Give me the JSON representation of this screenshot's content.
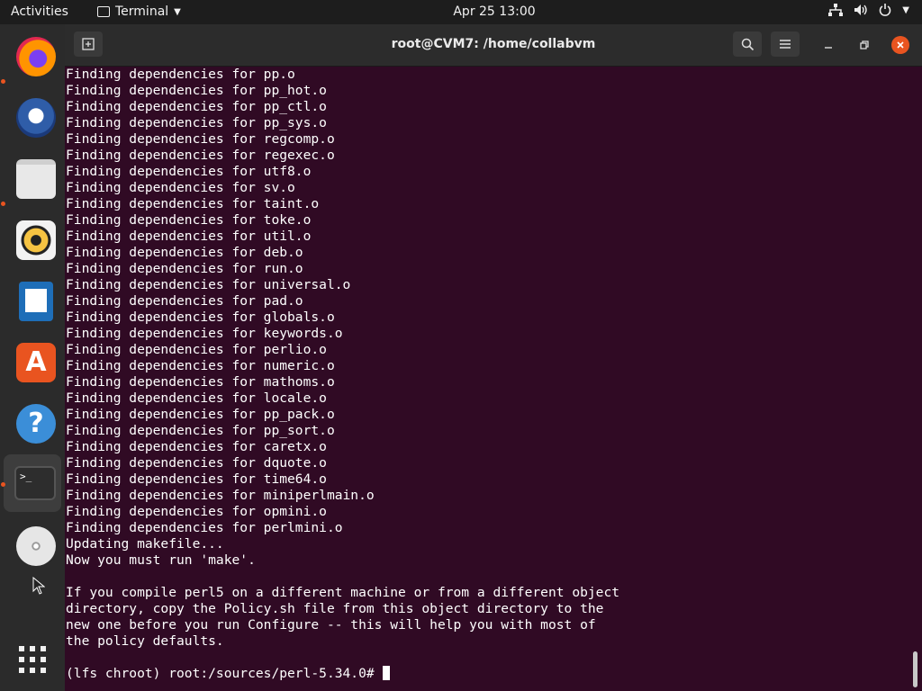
{
  "topbar": {
    "activities": "Activities",
    "app_name": "Terminal",
    "clock": "Apr 25  13:00"
  },
  "dock": {
    "items": [
      "Firefox",
      "Thunderbird",
      "Files",
      "Rhythmbox",
      "LibreOffice Writer",
      "Ubuntu Software",
      "Help",
      "Terminal",
      "DVD",
      "Show Applications"
    ]
  },
  "window": {
    "title": "root@CVM7: /home/collabvm"
  },
  "terminal": {
    "lines": [
      "Finding dependencies for pp.o",
      "Finding dependencies for pp_hot.o",
      "Finding dependencies for pp_ctl.o",
      "Finding dependencies for pp_sys.o",
      "Finding dependencies for regcomp.o",
      "Finding dependencies for regexec.o",
      "Finding dependencies for utf8.o",
      "Finding dependencies for sv.o",
      "Finding dependencies for taint.o",
      "Finding dependencies for toke.o",
      "Finding dependencies for util.o",
      "Finding dependencies for deb.o",
      "Finding dependencies for run.o",
      "Finding dependencies for universal.o",
      "Finding dependencies for pad.o",
      "Finding dependencies for globals.o",
      "Finding dependencies for keywords.o",
      "Finding dependencies for perlio.o",
      "Finding dependencies for numeric.o",
      "Finding dependencies for mathoms.o",
      "Finding dependencies for locale.o",
      "Finding dependencies for pp_pack.o",
      "Finding dependencies for pp_sort.o",
      "Finding dependencies for caretx.o",
      "Finding dependencies for dquote.o",
      "Finding dependencies for time64.o",
      "Finding dependencies for miniperlmain.o",
      "Finding dependencies for opmini.o",
      "Finding dependencies for perlmini.o",
      "Updating makefile...",
      "Now you must run 'make'.",
      "",
      "If you compile perl5 on a different machine or from a different object",
      "directory, copy the Policy.sh file from this object directory to the",
      "new one before you run Configure -- this will help you with most of",
      "the policy defaults.",
      ""
    ],
    "prompt": "(lfs chroot) root:/sources/perl-5.34.0# "
  }
}
